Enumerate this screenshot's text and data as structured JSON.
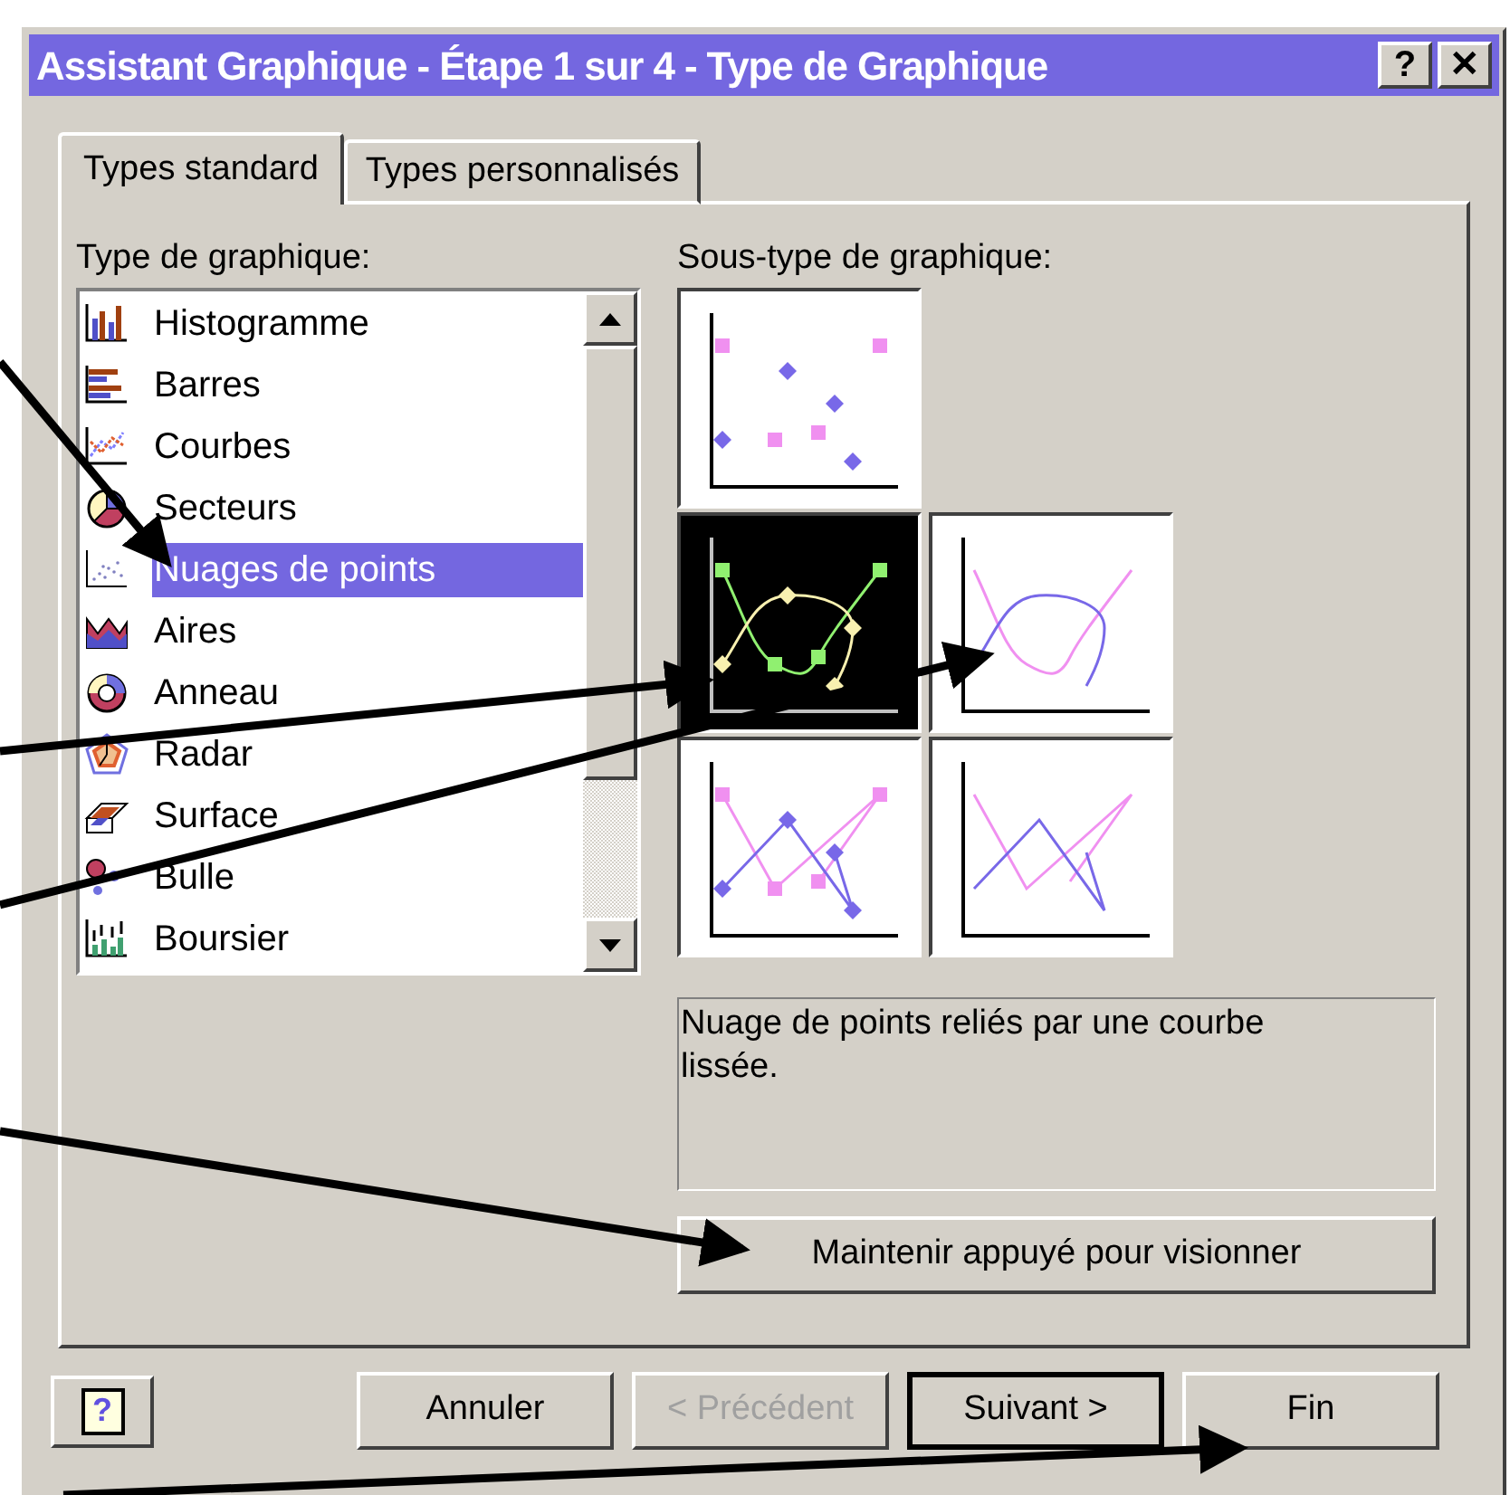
{
  "window": {
    "title": "Assistant Graphique - Étape 1 sur 4 - Type de Graphique",
    "buttons": [
      "?",
      "✕"
    ]
  },
  "tabs": [
    {
      "label": "Types standard",
      "selected": true
    },
    {
      "label": "Types personnalisés",
      "selected": false
    }
  ],
  "chart_types": {
    "label": "Type de graphique:",
    "items": [
      {
        "label": "Histogramme",
        "kind": "column",
        "selected": false
      },
      {
        "label": "Barres",
        "kind": "bar",
        "selected": false
      },
      {
        "label": "Courbes",
        "kind": "line",
        "selected": false
      },
      {
        "label": "Secteurs",
        "kind": "pie",
        "selected": false
      },
      {
        "label": "Nuages de points",
        "kind": "scatter",
        "selected": true
      },
      {
        "label": "Aires",
        "kind": "area",
        "selected": false
      },
      {
        "label": "Anneau",
        "kind": "doughnut",
        "selected": false
      },
      {
        "label": "Radar",
        "kind": "radar",
        "selected": false
      },
      {
        "label": "Surface",
        "kind": "surface",
        "selected": false
      },
      {
        "label": "Bulle",
        "kind": "bubble",
        "selected": false
      },
      {
        "label": "Boursier",
        "kind": "stock",
        "selected": false
      }
    ]
  },
  "subtypes": {
    "label": "Sous-type de graphique:",
    "items": [
      {
        "kind": "markers",
        "selected": false
      },
      {
        "kind": "smooth-markers",
        "selected": true
      },
      {
        "kind": "smooth",
        "selected": false
      },
      {
        "kind": "lines-markers",
        "selected": false
      },
      {
        "kind": "lines",
        "selected": false
      }
    ]
  },
  "description": "Nuage de points reliés par une courbe lissée.",
  "preview_button": "Maintenir appuyé pour visionner",
  "footer": {
    "help": "?",
    "buttons": [
      {
        "label": "Annuler",
        "disabled": false,
        "default": false
      },
      {
        "label": "< Précédent",
        "disabled": true,
        "default": false
      },
      {
        "label": "Suivant >",
        "disabled": false,
        "default": true
      },
      {
        "label": "Fin",
        "disabled": false,
        "default": false
      }
    ]
  }
}
